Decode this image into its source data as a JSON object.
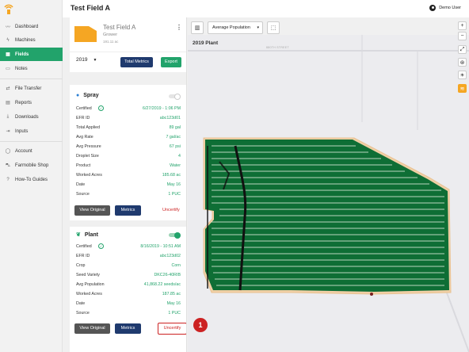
{
  "app": {
    "page_title": "Test Field A",
    "user_name": "Demo User"
  },
  "sidebar": {
    "items": [
      {
        "label": "Dashboard",
        "icon": "dashboard-icon"
      },
      {
        "label": "Machines",
        "icon": "lightning-icon"
      },
      {
        "label": "Fields",
        "icon": "fields-icon",
        "active": true
      },
      {
        "label": "Notes",
        "icon": "notes-icon"
      },
      {
        "label": "File Transfer",
        "icon": "transfer-icon"
      },
      {
        "label": "Reports",
        "icon": "reports-icon"
      },
      {
        "label": "Downloads",
        "icon": "download-icon"
      },
      {
        "label": "Inputs",
        "icon": "inputs-icon"
      },
      {
        "label": "Account",
        "icon": "account-icon"
      },
      {
        "label": "Farmobile Shop",
        "icon": "cart-icon"
      },
      {
        "label": "How-To Guides",
        "icon": "help-icon"
      }
    ]
  },
  "field": {
    "name": "Test Field A",
    "role": "Grower",
    "acres": "191.11 ac",
    "thumb_color": "#f5a623"
  },
  "toolbar": {
    "year": "2019",
    "total_metrics_label": "Total Metrics",
    "export_label": "Export"
  },
  "spray": {
    "title": "Spray",
    "rows": [
      {
        "label": "Certified",
        "value": "6/27/2019 - 1:06 PM"
      },
      {
        "label": "EFR ID",
        "value": "abc123d01"
      },
      {
        "label": "Total Applied",
        "value": "89 gal"
      },
      {
        "label": "Avg Rate",
        "value": "7 gal/ac"
      },
      {
        "label": "Avg Pressure",
        "value": "67 psi"
      },
      {
        "label": "Droplet Size",
        "value": "4"
      },
      {
        "label": "Product",
        "value": "Water"
      },
      {
        "label": "Worked Acres",
        "value": "185.68 ac"
      },
      {
        "label": "Date",
        "value": "May 16"
      },
      {
        "label": "Source",
        "value": "1 PUC"
      }
    ],
    "view_original_label": "View Original",
    "metrics_label": "Metrics",
    "uncertify_label": "Uncertify"
  },
  "plant": {
    "title": "Plant",
    "rows": [
      {
        "label": "Certified",
        "value": "8/16/2019 - 10:51 AM"
      },
      {
        "label": "EFR ID",
        "value": "abc123d02"
      },
      {
        "label": "Crop",
        "value": "Corn"
      },
      {
        "label": "Seed Variety",
        "value": "DKC26-40RIB"
      },
      {
        "label": "Avg Population",
        "value": "41,868.22 seeds/ac"
      },
      {
        "label": "Worked Acres",
        "value": "187.85 ac"
      },
      {
        "label": "Date",
        "value": "May 16"
      },
      {
        "label": "Source",
        "value": "1 PUC"
      }
    ],
    "view_original_label": "View Original",
    "metrics_label": "Metrics",
    "uncertify_label": "Uncertify"
  },
  "map": {
    "layer_select": "Average Population",
    "layer_label": "2019 Plant",
    "street_label": "880TH STREET",
    "callout_number": "1"
  }
}
